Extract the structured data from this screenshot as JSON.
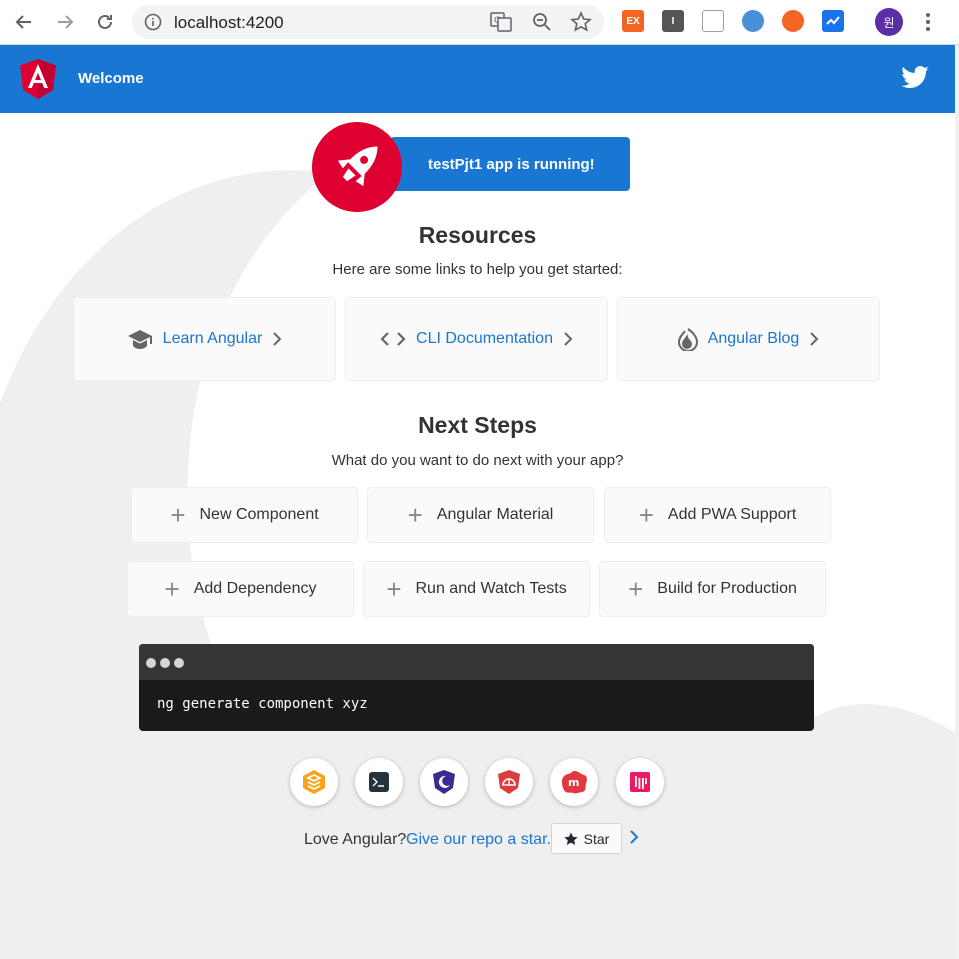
{
  "browser": {
    "url": "localhost:4200",
    "profile_initial": "원",
    "extensions": [
      {
        "name": "ex-extension",
        "label": "EX",
        "color": "#f26522"
      },
      {
        "name": "reader-extension",
        "label": "I",
        "color": "#555555"
      },
      {
        "name": "memo-extension",
        "label": "",
        "color": "#9e9e9e"
      },
      {
        "name": "blue-circle-extension",
        "label": "",
        "color": "#4a90d9"
      },
      {
        "name": "orange-extension",
        "label": "",
        "color": "#f26522"
      },
      {
        "name": "check-extension",
        "label": "",
        "color": "#1a73e8"
      }
    ]
  },
  "toolbar": {
    "welcome": "Welcome",
    "brand_color": "#1976d2"
  },
  "running": {
    "text": "testPjt1 app is running!"
  },
  "resources": {
    "title": "Resources",
    "subtitle": "Here are some links to help you get started:",
    "links": [
      {
        "label": "Learn Angular",
        "icon": "graduation-cap-icon"
      },
      {
        "label": "CLI Documentation",
        "icon": "code-icon"
      },
      {
        "label": "Angular Blog",
        "icon": "flame-icon"
      }
    ]
  },
  "next_steps": {
    "title": "Next Steps",
    "subtitle": "What do you want to do next with your app?",
    "row1": [
      "New Component",
      "Angular Material",
      "Add PWA Support"
    ],
    "row2": [
      "Add Dependency",
      "Run and Watch Tests",
      "Build for Production"
    ]
  },
  "terminal": {
    "command": "ng generate component xyz"
  },
  "ecosystem": [
    {
      "name": "animations-link",
      "icon": "stack-icon"
    },
    {
      "name": "cli-link",
      "icon": "terminal-icon"
    },
    {
      "name": "augury-link",
      "icon": "moon-shield-icon"
    },
    {
      "name": "protractor-link",
      "icon": "angular-shield-icon"
    },
    {
      "name": "meetup-link",
      "icon": "meetup-icon"
    },
    {
      "name": "gitter-link",
      "icon": "gitter-icon"
    }
  ],
  "footer": {
    "love": "Love Angular?",
    "give": "Give our repo a star.",
    "star": "Star"
  }
}
